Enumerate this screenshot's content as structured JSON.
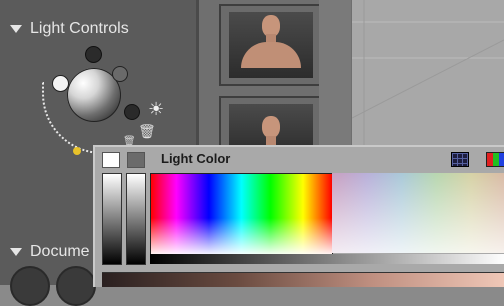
{
  "left_panel": {
    "light_controls_title": "Light Controls",
    "document_title": "Docume"
  },
  "color_picker": {
    "title": "Light Color"
  },
  "icons": {
    "expand_triangle": "triangle-down-icon",
    "sun": "sun-icon",
    "trash": "trash-icon",
    "grid": "grid-icon",
    "rgb": "rgb-icon"
  },
  "colors": {
    "panel_bg": "#5b5b5b",
    "picker_bg": "#a9a9a9",
    "accent_yellow": "#e8c22a"
  }
}
